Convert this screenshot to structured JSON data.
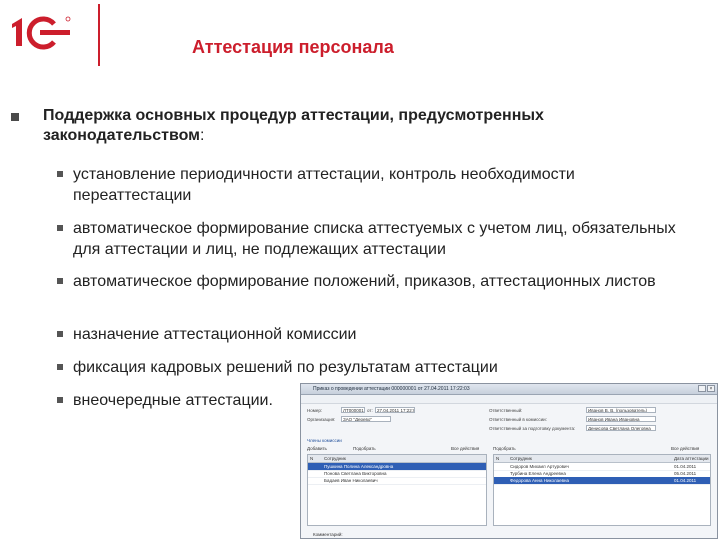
{
  "header": {
    "title": "Аттестация персонала"
  },
  "main_point": {
    "text": "Поддержка основных процедур аттестации, предусмотренных законодательством",
    "colon": ":"
  },
  "sub_points": [
    "установление периодичности аттестации, контроль необходимости переаттестации",
    "автоматическое формирование списка аттестуемых с учетом лиц, обязательных   для аттестации и лиц, не подлежащих аттестации",
    "автоматическое формирование положений, приказов, аттестационных листов",
    "назначение аттестационной комиссии",
    "фиксация кадровых решений по результатам аттестации",
    "внеочередные аттестации."
  ],
  "screenshot": {
    "window_title": "Приказ о проведении аттестации 000000001 от 27.04.2011 17:22:03",
    "close_glyph": "×",
    "fields": {
      "number_label": "Номер:",
      "number_value": "ЛТ000001",
      "date_label": "от:",
      "date_value": "27.04.2011 17:22:03",
      "org_label": "Организация:",
      "org_value": "ЗАО \"Дерево\""
    },
    "right_fields": {
      "resp_label": "Ответственный:",
      "resp_value": "Иванов В. В. (пользователь)",
      "kom_label": "Ответственный в комиссии:",
      "kom_value": "Иванов Ивана Ивановна",
      "sec_label": "Ответственный за подготовку документа:",
      "sec_value": "Денисова Светлана Олеговна"
    },
    "left_panel": {
      "section": "Члены комиссии",
      "toolbar": [
        "Добавить",
        "Подобрать",
        "Все действия"
      ],
      "header": [
        "N",
        "Сотрудник"
      ],
      "rows": [
        "Пушкина Полина Александровна",
        "Понова Светлана Викторовна",
        "Бадаев Иван Николаевич"
      ]
    },
    "right_panel": {
      "toolbar": [
        "Подобрать",
        "Все действия"
      ],
      "header": [
        "N",
        "Сотрудник",
        "Дата аттестации"
      ],
      "rows": [
        [
          "Сидоров Михаил Артурович",
          "01.04.2011"
        ],
        [
          "Турбина Елена Андреевна",
          "05.04.2011"
        ],
        [
          "Федорова Анна Николаевна",
          "01.04.2011"
        ]
      ]
    },
    "status": "Комментарий:"
  }
}
